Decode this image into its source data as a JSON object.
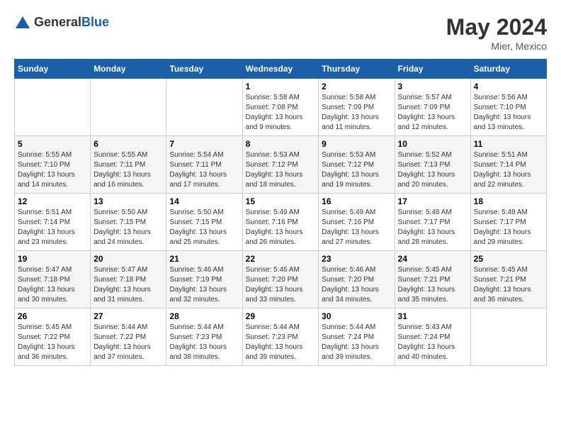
{
  "logo": {
    "text_general": "General",
    "text_blue": "Blue"
  },
  "header": {
    "month_year": "May 2024",
    "location": "Mier, Mexico"
  },
  "weekdays": [
    "Sunday",
    "Monday",
    "Tuesday",
    "Wednesday",
    "Thursday",
    "Friday",
    "Saturday"
  ],
  "weeks": [
    [
      {
        "day": "",
        "info": ""
      },
      {
        "day": "",
        "info": ""
      },
      {
        "day": "",
        "info": ""
      },
      {
        "day": "1",
        "info": "Sunrise: 5:58 AM\nSunset: 7:08 PM\nDaylight: 13 hours and 9 minutes."
      },
      {
        "day": "2",
        "info": "Sunrise: 5:58 AM\nSunset: 7:09 PM\nDaylight: 13 hours and 11 minutes."
      },
      {
        "day": "3",
        "info": "Sunrise: 5:57 AM\nSunset: 7:09 PM\nDaylight: 13 hours and 12 minutes."
      },
      {
        "day": "4",
        "info": "Sunrise: 5:56 AM\nSunset: 7:10 PM\nDaylight: 13 hours and 13 minutes."
      }
    ],
    [
      {
        "day": "5",
        "info": "Sunrise: 5:55 AM\nSunset: 7:10 PM\nDaylight: 13 hours and 14 minutes."
      },
      {
        "day": "6",
        "info": "Sunrise: 5:55 AM\nSunset: 7:11 PM\nDaylight: 13 hours and 16 minutes."
      },
      {
        "day": "7",
        "info": "Sunrise: 5:54 AM\nSunset: 7:11 PM\nDaylight: 13 hours and 17 minutes."
      },
      {
        "day": "8",
        "info": "Sunrise: 5:53 AM\nSunset: 7:12 PM\nDaylight: 13 hours and 18 minutes."
      },
      {
        "day": "9",
        "info": "Sunrise: 5:53 AM\nSunset: 7:12 PM\nDaylight: 13 hours and 19 minutes."
      },
      {
        "day": "10",
        "info": "Sunrise: 5:52 AM\nSunset: 7:13 PM\nDaylight: 13 hours and 20 minutes."
      },
      {
        "day": "11",
        "info": "Sunrise: 5:51 AM\nSunset: 7:14 PM\nDaylight: 13 hours and 22 minutes."
      }
    ],
    [
      {
        "day": "12",
        "info": "Sunrise: 5:51 AM\nSunset: 7:14 PM\nDaylight: 13 hours and 23 minutes."
      },
      {
        "day": "13",
        "info": "Sunrise: 5:50 AM\nSunset: 7:15 PM\nDaylight: 13 hours and 24 minutes."
      },
      {
        "day": "14",
        "info": "Sunrise: 5:50 AM\nSunset: 7:15 PM\nDaylight: 13 hours and 25 minutes."
      },
      {
        "day": "15",
        "info": "Sunrise: 5:49 AM\nSunset: 7:16 PM\nDaylight: 13 hours and 26 minutes."
      },
      {
        "day": "16",
        "info": "Sunrise: 5:49 AM\nSunset: 7:16 PM\nDaylight: 13 hours and 27 minutes."
      },
      {
        "day": "17",
        "info": "Sunrise: 5:48 AM\nSunset: 7:17 PM\nDaylight: 13 hours and 28 minutes."
      },
      {
        "day": "18",
        "info": "Sunrise: 5:48 AM\nSunset: 7:17 PM\nDaylight: 13 hours and 29 minutes."
      }
    ],
    [
      {
        "day": "19",
        "info": "Sunrise: 5:47 AM\nSunset: 7:18 PM\nDaylight: 13 hours and 30 minutes."
      },
      {
        "day": "20",
        "info": "Sunrise: 5:47 AM\nSunset: 7:18 PM\nDaylight: 13 hours and 31 minutes."
      },
      {
        "day": "21",
        "info": "Sunrise: 5:46 AM\nSunset: 7:19 PM\nDaylight: 13 hours and 32 minutes."
      },
      {
        "day": "22",
        "info": "Sunrise: 5:46 AM\nSunset: 7:20 PM\nDaylight: 13 hours and 33 minutes."
      },
      {
        "day": "23",
        "info": "Sunrise: 5:46 AM\nSunset: 7:20 PM\nDaylight: 13 hours and 34 minutes."
      },
      {
        "day": "24",
        "info": "Sunrise: 5:45 AM\nSunset: 7:21 PM\nDaylight: 13 hours and 35 minutes."
      },
      {
        "day": "25",
        "info": "Sunrise: 5:45 AM\nSunset: 7:21 PM\nDaylight: 13 hours and 36 minutes."
      }
    ],
    [
      {
        "day": "26",
        "info": "Sunrise: 5:45 AM\nSunset: 7:22 PM\nDaylight: 13 hours and 36 minutes."
      },
      {
        "day": "27",
        "info": "Sunrise: 5:44 AM\nSunset: 7:22 PM\nDaylight: 13 hours and 37 minutes."
      },
      {
        "day": "28",
        "info": "Sunrise: 5:44 AM\nSunset: 7:23 PM\nDaylight: 13 hours and 38 minutes."
      },
      {
        "day": "29",
        "info": "Sunrise: 5:44 AM\nSunset: 7:23 PM\nDaylight: 13 hours and 39 minutes."
      },
      {
        "day": "30",
        "info": "Sunrise: 5:44 AM\nSunset: 7:24 PM\nDaylight: 13 hours and 39 minutes."
      },
      {
        "day": "31",
        "info": "Sunrise: 5:43 AM\nSunset: 7:24 PM\nDaylight: 13 hours and 40 minutes."
      },
      {
        "day": "",
        "info": ""
      }
    ]
  ]
}
